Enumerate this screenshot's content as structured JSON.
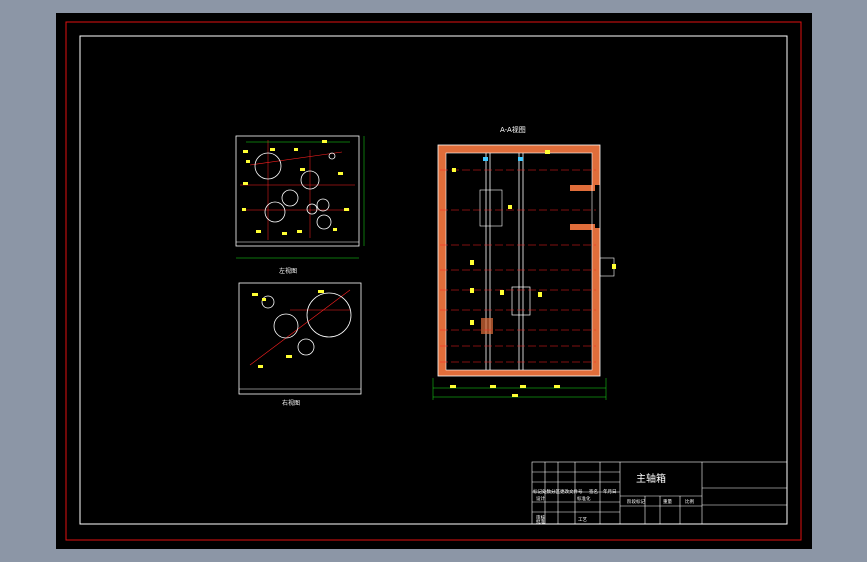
{
  "colors": {
    "background_outer": "#8c96a6",
    "sheet": "#000000",
    "frame": "#e01010",
    "outline": "#ffffff",
    "dimension": "#19e619",
    "centerline": "#ff2020",
    "hatch": "#e06d3a",
    "highlight": "#ffff33",
    "accent": "#40c8ff"
  },
  "views": {
    "left_top_title": "左视图",
    "left_bottom_title": "右视图",
    "section_title": "A-A视图"
  },
  "title_block": {
    "drawing_name": "主轴箱",
    "row_label_1": "标记处数分区更改文件号",
    "row_label_2": "签名",
    "row_label_3": "年月日",
    "cell_design": "设计",
    "cell_std": "标准化",
    "cell_review": "审核",
    "cell_process": "工艺",
    "cell_approve": "批准",
    "stage_marks": "阶段标记",
    "weight": "重量",
    "scale": "比例"
  }
}
